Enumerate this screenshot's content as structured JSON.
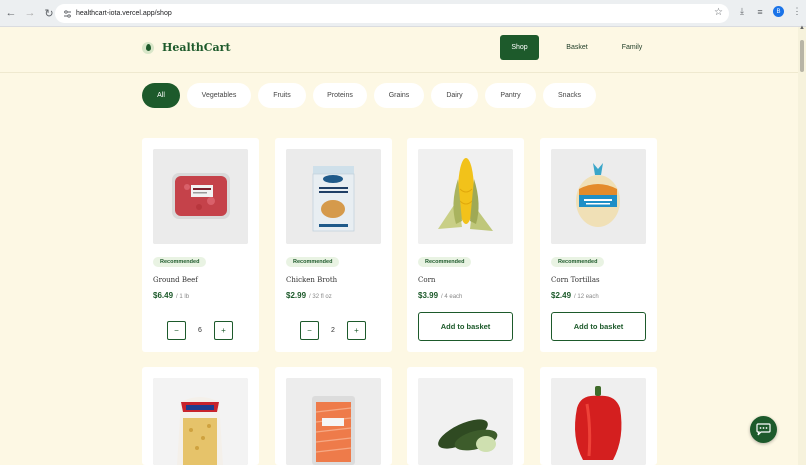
{
  "browser": {
    "url": "healthcart-iota.vercel.app/shop",
    "avatar_letter": "B"
  },
  "header": {
    "logo_text": "HealthCart",
    "nav": [
      {
        "label": "Shop",
        "active": true
      },
      {
        "label": "Basket",
        "active": false
      },
      {
        "label": "Family",
        "active": false
      }
    ]
  },
  "categories": [
    "All",
    "Vegetables",
    "Fruits",
    "Proteins",
    "Grains",
    "Dairy",
    "Pantry",
    "Snacks"
  ],
  "products": [
    {
      "badge": "Recommended",
      "name": "Ground Beef",
      "price": "$6.49",
      "unit": "/ 1 lb",
      "qty": "6",
      "control": "stepper"
    },
    {
      "badge": "Recommended",
      "name": "Chicken Broth",
      "price": "$2.99",
      "unit": "/ 32 fl oz",
      "qty": "2",
      "control": "stepper"
    },
    {
      "badge": "Recommended",
      "name": "Corn",
      "price": "$3.99",
      "unit": "/ 4 each",
      "control": "add",
      "add_label": "Add to basket"
    },
    {
      "badge": "Recommended",
      "name": "Corn Tortillas",
      "price": "$2.49",
      "unit": "/ 12 each",
      "control": "add",
      "add_label": "Add to basket"
    }
  ],
  "stepper": {
    "minus": "−",
    "plus": "+"
  },
  "colors": {
    "brand_green": "#1d5a2b",
    "page_bg": "#fdf8e4",
    "badge_bg": "#e9f3e3"
  }
}
